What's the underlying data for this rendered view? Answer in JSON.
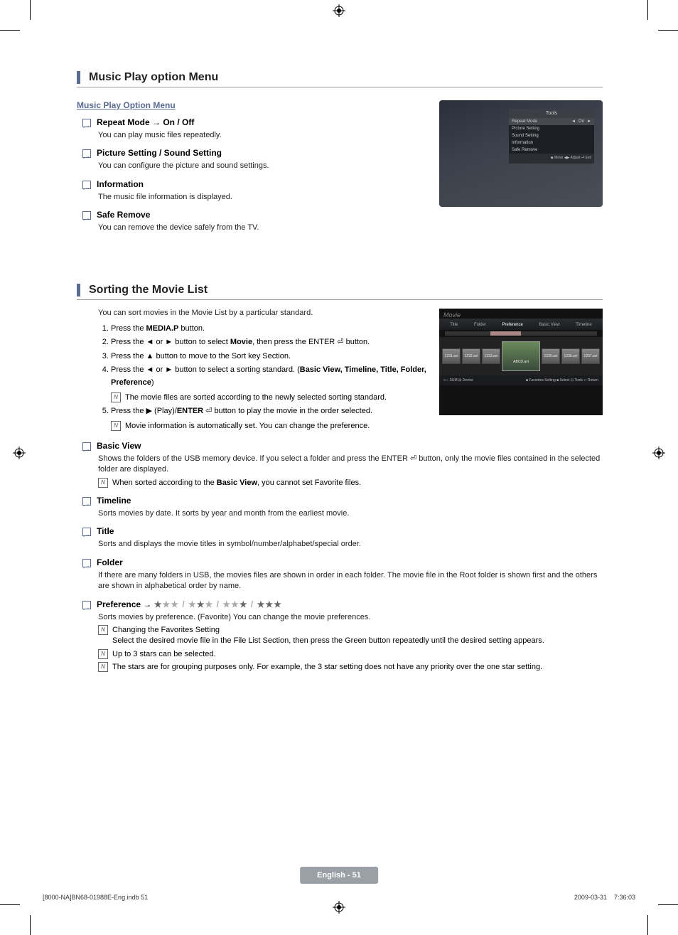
{
  "section1": {
    "title": "Music Play option Menu",
    "subheading": "Music Play Option Menu",
    "items": [
      {
        "title": "Repeat Mode → On / Off",
        "body": "You can play music files repeatedly."
      },
      {
        "title": "Picture Setting / Sound Setting",
        "body": "You can configure the picture and sound settings."
      },
      {
        "title": "Information",
        "body": "The music file information is displayed."
      },
      {
        "title": "Safe Remove",
        "body": "You can remove the device safely from the TV."
      }
    ]
  },
  "tools_panel": {
    "header": "Tools",
    "rows": [
      {
        "label": "Repeat Mode",
        "value_left": "◄",
        "value_mid": "On",
        "value_right": "►",
        "selected": true
      },
      {
        "label": "Picture Setting"
      },
      {
        "label": "Sound Setting"
      },
      {
        "label": "Information"
      },
      {
        "label": "Safe Remove"
      }
    ],
    "footer": "◆ Move   ◀▶ Adjust   ⮐ Exit"
  },
  "section2": {
    "title": "Sorting the Movie List",
    "intro": "You can sort movies in the Movie List by a particular standard.",
    "steps": [
      {
        "pre": "Press the ",
        "bold": "MEDIA.P",
        "post": " button."
      },
      {
        "pre": "Press the ◄ or ► button to select ",
        "bold": "Movie",
        "post": ", then press the ENTER ⏎ button."
      },
      {
        "pre": "Press the ▲ button to move to the Sort key Section.",
        "bold": "",
        "post": ""
      },
      {
        "pre": "Press the ◄ or ► button to select a sorting standard. (",
        "bold": "Basic View, Timeline, Title, Folder, Preference",
        "post": ")"
      },
      {
        "pre": "Press the ▶ (Play)/",
        "bold": "ENTER",
        "post": " ⏎ button to play the movie in the order selected."
      }
    ],
    "step4_note": "The movie files are sorted according to the newly selected sorting standard.",
    "step5_note": "Movie information is automatically set. You can change the preference.",
    "items": [
      {
        "title": "Basic View",
        "body": "Shows the folders of the USB memory device. If you select a folder and press the ENTER ⏎ button, only the movie files contained in the selected folder are displayed.",
        "notes": [
          {
            "pre": "When sorted according to the ",
            "bold": "Basic View",
            "post": ", you cannot set Favorite files."
          }
        ]
      },
      {
        "title": "Timeline",
        "body": "Sorts movies by date. It sorts by year and month from the earliest movie."
      },
      {
        "title": "Title",
        "body": "Sorts and displays the movie titles in symbol/number/alphabet/special order."
      },
      {
        "title": "Folder",
        "body": "If there are many folders in USB, the movies files are shown in order in each folder. The movie file in the Root folder is shown first and the others are shown in alphabetical order by name."
      },
      {
        "title_raw": "Preference → ",
        "stars": true,
        "body": "Sorts movies by preference. (Favorite) You can change the movie preferences.",
        "notes": [
          {
            "pre": "Changing the Favorites Setting\nSelect the desired movie file in the File List Section, then press the Green button repeatedly until the desired setting appears.",
            "bold": "",
            "post": ""
          },
          {
            "pre": "Up to 3 stars can be selected.",
            "bold": "",
            "post": ""
          },
          {
            "pre": "The stars are for grouping purposes only. For example, the 3 star setting does not have any priority over the one star setting.",
            "bold": "",
            "post": ""
          }
        ]
      }
    ]
  },
  "movie_screen": {
    "tabs": [
      "Title",
      "Folder",
      "Preference",
      "Basic View",
      "Timeline"
    ],
    "selected_tab": "Preference",
    "thumbs_left": [
      "1231.avi",
      "1232.avi",
      "1233.avi"
    ],
    "thumb_big": "ABCD.avi",
    "thumbs_right": [
      "1235.avi",
      "1236.avi",
      "1237.avi"
    ],
    "footer_left": "⟵ SUM   ⊞ Device",
    "footer_right": "■ Favorites Setting  ■ Select  ⊡ Tools  ↩ Return"
  },
  "page_footer": {
    "badge": "English - 51",
    "left": "[8000-NA]BN68-01988E-Eng.indb   51",
    "right": "2009-03-31      7:36:03"
  }
}
